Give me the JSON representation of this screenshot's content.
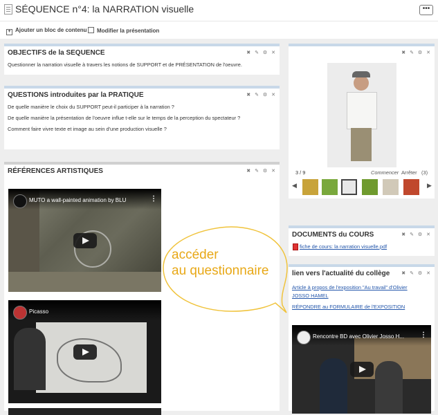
{
  "header": {
    "title": "SÉQUENCE n°4: la NARRATION visuelle",
    "more_label": "•••"
  },
  "toolbar": {
    "add_block": "Ajouter un bloc de contenu",
    "edit_presentation": "Modifier la présentation"
  },
  "block_controls": "✖ ✎ ⚙ ✕",
  "objectifs": {
    "title": "OBJECTIFS de la SEQUENCE",
    "text": "Questionner la narration visuelle à travers les notions de SUPPORT et de PRÉSENTATION de l'oeuvre."
  },
  "questions": {
    "title": "QUESTIONS introduites par la PRATIQUE",
    "lines": [
      "De quelle manière le choix du SUPPORT peut-il participer à la narration ?",
      "De quelle manière la présentation de l'oeuvre influe t-elle sur le temps de la perception du spectateur ?",
      "Comment faire vivre texte et image au sein d'une production visuelle ?"
    ]
  },
  "references": {
    "title": "RÉFÉRENCES ARTISTIQUES",
    "videos": [
      {
        "title": "MUTO a wall-painted animation by BLU"
      },
      {
        "title": "Picasso"
      }
    ]
  },
  "gallery": {
    "counter": "3 / 9",
    "start_label": "Commencer",
    "stop_label": "Arrêter",
    "count": "(3)",
    "prev": "◀",
    "next": "▶"
  },
  "documents": {
    "title": "DOCUMENTS du COURS",
    "file": "fiche de cours: la narration visuelle.pdf",
    "file_icon": "pdf-icon"
  },
  "college": {
    "title": "lien vers l'actualité du collège",
    "link1_line1": "Article à propos de l'exposition \"Au travail\" d'Olivier",
    "link1_line2": "JOSSO HAMEL",
    "link2": "RÉPONDRE au FORMULAIRE de l'EXPOSITION",
    "video_title": "Rencontre BD avec Olivier Josso H..."
  },
  "annotation": {
    "line1": "accéder",
    "line2": "au questionnaire",
    "color": "#e8a817"
  }
}
